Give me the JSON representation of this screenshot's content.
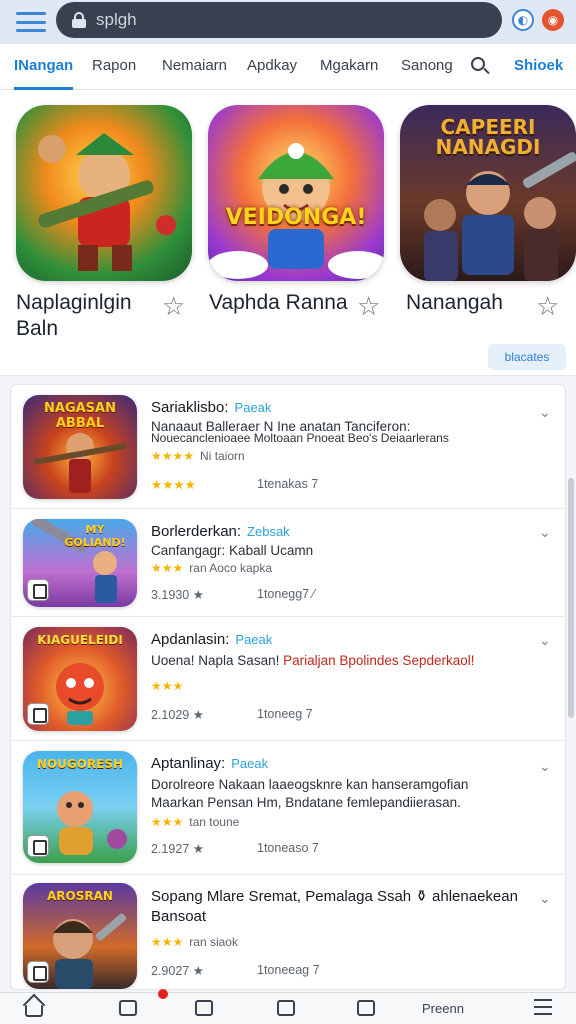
{
  "search": {
    "placeholder": "splgh"
  },
  "tabs": [
    {
      "label": "INangan"
    },
    {
      "label": "Rapon"
    },
    {
      "label": "Nemaiarn"
    },
    {
      "label": "Apdkay"
    },
    {
      "label": "Mgakarn"
    },
    {
      "label": "Sanong"
    },
    {
      "label": "Shioek"
    }
  ],
  "featured": {
    "apps": [
      {
        "name": "Naplaginlgin Baln",
        "art_text": ""
      },
      {
        "name": "Vaphda Ranna",
        "art_text": "VEIDONGA!"
      },
      {
        "name": "Nanangah",
        "art_text": "CAPEERI NANAGDI"
      }
    ],
    "details_label": "blacates"
  },
  "list": {
    "rows": [
      {
        "title": "Sariaklisbo:",
        "tag": "Paeak",
        "lines": [
          "Nanaaut Balleraer N Ine anatan Tanciferon:",
          "Nouecanclenioaee Moltoaan Pnoeat Beo's Deiaarlerans"
        ],
        "rating": "★★★★",
        "rating_text": "Ni taiorn",
        "meta_left": "★★★★",
        "meta_right": "1tenakas 7",
        "icon_text": "NAGASAN ABBAL"
      },
      {
        "title": "Borlerderkan:",
        "tag": "Zebsak",
        "lines": [
          "Canfangagr: Kaball Ucamn"
        ],
        "rating": "★★★",
        "rating_text": "ran Aoco kapka",
        "meta_left": "3.1930 ★",
        "meta_right": "1tonegg7 ⁄",
        "icon_text": "MY GOLIAND!"
      },
      {
        "title": "Apdanlasin:",
        "tag": "Paeak",
        "lines": [
          "Uoena! Napla Sasan!"
        ],
        "red_line": "Parialjan Bpolindes Sepderkaol!",
        "rating": "★★★",
        "rating_text": "",
        "meta_left": "2.1029 ★",
        "meta_right": "1toneeg 7",
        "icon_text": "KIAGUELEIDI"
      },
      {
        "title": "Aptanlinay:",
        "tag": "Paeak",
        "lines": [
          "Dorolreore Nakaan laaeogsknre kan hanseramgofian",
          "Maarkan Pensan Hm, Bndatane femlepandiierasan."
        ],
        "rating": "★★★",
        "rating_text": "tan toune",
        "meta_left": "2.1927 ★",
        "meta_right": "1toneaso 7",
        "icon_text": "NOUGORESH"
      },
      {
        "title": "Sopang Mlare Sremat, Pemalaga Ssah ⚱ ahlenaekean Bansoat",
        "tag": "",
        "lines": [],
        "rating": "★★★",
        "rating_text": "ran siaok",
        "meta_left": "2.9027 ★",
        "meta_right": "1toneeag 7",
        "icon_text": "AROSRAN"
      }
    ]
  },
  "bottom_nav": {
    "label": "Preenn"
  },
  "colors": {
    "accent": "#1c7fd6",
    "topbar": "#dfe9f5",
    "search": "#37414f"
  }
}
